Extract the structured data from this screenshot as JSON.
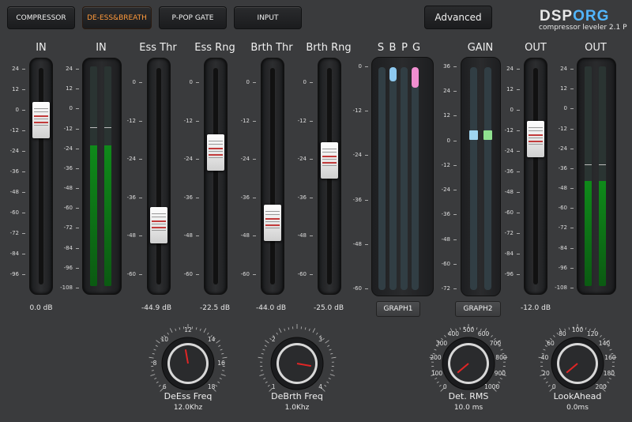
{
  "tabs": [
    {
      "label": "COMPRESSOR",
      "active": false
    },
    {
      "label": "DE-ESS&BREATH",
      "active": true
    },
    {
      "label": "P-POP GATE",
      "active": false
    },
    {
      "label": "INPUT",
      "active": false
    }
  ],
  "advanced_label": "Advanced",
  "logo": {
    "part1": "DSP",
    "part2": "ORG",
    "subtitle": "compressor leveler 2.1 P"
  },
  "columns": {
    "in_slider": {
      "header": "IN",
      "value": "0.0 dB",
      "level_db": 0
    },
    "in_meter": {
      "header": "IN"
    },
    "ess_thr": {
      "header": "Ess Thr",
      "value": "-44.9 dB",
      "level_db": -44.9
    },
    "ess_rng": {
      "header": "Ess Rng",
      "value": "-22.5 dB",
      "level_db": -22.5
    },
    "brth_thr": {
      "header": "Brth Thr",
      "value": "-44.0 dB",
      "level_db": -44.0
    },
    "brth_rng": {
      "header": "Brth Rng",
      "value": "-25.0 dB",
      "level_db": -25.0
    },
    "sbpg": {
      "letters": [
        "S",
        "B",
        "P",
        "G"
      ]
    },
    "gain": {
      "header": "GAIN"
    },
    "out_slider": {
      "header": "OUT",
      "value": "-12.0 dB",
      "level_db": -12
    },
    "out_meter": {
      "header": "OUT"
    }
  },
  "scales": {
    "in": [
      "24",
      "12",
      "0",
      "-12",
      "-24",
      "-36",
      "-48",
      "-60",
      "-72",
      "-84",
      "-96"
    ],
    "meter": [
      "24",
      "12",
      "0",
      "-12",
      "-24",
      "-36",
      "-48",
      "-60",
      "-72",
      "-84",
      "-96",
      "-108"
    ],
    "thr": [
      "0",
      "-12",
      "-24",
      "-36",
      "-48",
      "-60"
    ],
    "spec": [
      "0",
      "-12",
      "-24",
      "-36",
      "-48",
      "-60"
    ],
    "gain": [
      "36",
      "24",
      "12",
      "0",
      "-12",
      "-24",
      "-36",
      "-48",
      "-60",
      "-72"
    ],
    "out": [
      "24",
      "12",
      "0",
      "-12",
      "-24",
      "-36",
      "-48",
      "-60",
      "-72",
      "-84",
      "-96"
    ]
  },
  "graph_buttons": [
    "GRAPH1",
    "GRAPH2"
  ],
  "knobs": [
    {
      "label": "DeEss Freq",
      "value": "12.0Khz",
      "ticks": [
        "6",
        "8",
        "10",
        "12",
        "14",
        "16",
        "18"
      ]
    },
    {
      "label": "DeBrth Freq",
      "value": "1.0Khz",
      "ticks": [
        "1",
        "2",
        "3",
        "4"
      ]
    },
    {
      "label": "Det. RMS",
      "value": "10.0 ms",
      "ticks": [
        "0",
        "100",
        "200",
        "300",
        "400",
        "500",
        "600",
        "700",
        "800",
        "900",
        "1000"
      ]
    },
    {
      "label": "LookAhead",
      "value": "0.0ms",
      "ticks": [
        "0",
        "20",
        "40",
        "60",
        "80",
        "100",
        "120",
        "140",
        "160",
        "180",
        "200"
      ]
    }
  ],
  "colors": {
    "accent": "#ff9a3c",
    "logo_blue": "#52b6ff",
    "meter_green": "#0f8a1a",
    "sibilance": "#8ec9f0",
    "gate": "#f08ed0",
    "gain_blue": "#9fd5f0",
    "gain_green": "#8fe08f"
  }
}
